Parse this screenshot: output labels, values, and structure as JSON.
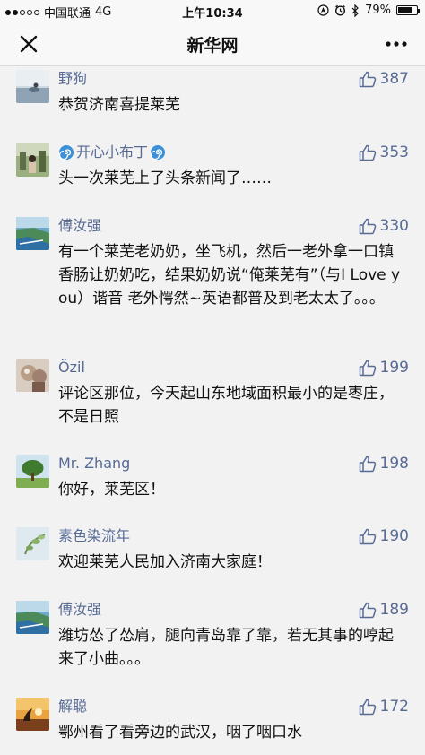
{
  "status_bar": {
    "carrier": "中国联通",
    "network": "4G",
    "time": "上午10:34",
    "battery": "79%",
    "battery_level": 0.79
  },
  "nav": {
    "title": "新华网"
  },
  "comments": [
    {
      "username": "野狗",
      "likes": "387",
      "text": "恭贺济南喜提莱芜"
    },
    {
      "username": "开心小布丁",
      "likes": "353",
      "text": "头一次莱芜上了头条新闻了……"
    },
    {
      "username": "傅汝强",
      "likes": "330",
      "text": "有一个莱芜老奶奶，坐飞机，然后一老外拿一口镇香肠让奶奶吃，结果奶奶说“俺莱芜有”（与I Love you）谐音 老外愕然~英语都普及到老太太了。。。"
    },
    {
      "username": "Özil",
      "likes": "199",
      "text": "评论区那位，今天起山东地域面积最小的是枣庄，不是日照"
    },
    {
      "username": "Mr. Zhang",
      "likes": "198",
      "text": "你好，莱芜区！"
    },
    {
      "username": "素色染流年",
      "likes": "190",
      "text": "欢迎莱芜人民加入济南大家庭！"
    },
    {
      "username": "傅汝强",
      "likes": "189",
      "text": "潍坊怂了怂肩，腿向青岛靠了靠，若无其事的哼起来了小曲。。。"
    },
    {
      "username": "解聪",
      "likes": "172",
      "text": "鄂州看了看旁边的武汉，咽了咽口水"
    }
  ]
}
